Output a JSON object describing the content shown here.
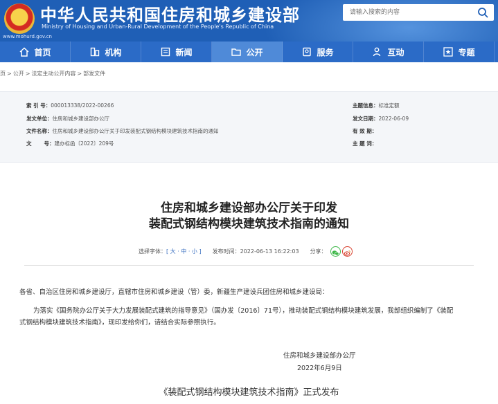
{
  "header": {
    "title_cn": "中华人民共和国住房和城乡建设部",
    "title_en": "Ministry of Housing and Urban-Rural Development of the People's Republic of China",
    "site_url": "www.mohurd.gov.cn",
    "search_placeholder": "请输入搜索的内容"
  },
  "nav": {
    "items": [
      {
        "label": "首页",
        "icon": "home-icon"
      },
      {
        "label": "机构",
        "icon": "building-icon"
      },
      {
        "label": "新闻",
        "icon": "news-icon"
      },
      {
        "label": "公开",
        "icon": "folder-icon",
        "active": true
      },
      {
        "label": "服务",
        "icon": "service-icon"
      },
      {
        "label": "互动",
        "icon": "user-icon"
      },
      {
        "label": "专题",
        "icon": "star-icon"
      }
    ]
  },
  "breadcrumb": [
    "页",
    "公开",
    "法定主动公开内容",
    "部发文件"
  ],
  "meta": {
    "index_label": "索 引 号：",
    "index_value": "000013338/2022-00266",
    "issuer_label": "发文单位：",
    "issuer_value": "住房和城乡建设部办公厅",
    "filename_label": "文件名称：",
    "filename_value": "住房和城乡建设部办公厅关于印发装配式钢结构模块建筑技术指南的通知",
    "docno_label": "文",
    "docno_label2": "号：",
    "docno_value": "建办标函〔2022〕209号",
    "topic_label": "主题信息：",
    "topic_value": "标准定额",
    "date_label": "发文日期：",
    "date_value": "2022-06-09",
    "valid_label": "有 效 期：",
    "valid_value": "",
    "keywords_label": "主 题 词：",
    "keywords_value": ""
  },
  "article": {
    "title_line1": "住房和城乡建设部办公厅关于印发",
    "title_line2": "装配式钢结构模块建筑技术指南的通知",
    "font_label": "选择字体：",
    "font_sizes": "[ 大 · 中 · 小 ]",
    "publish_label": "发布时间：",
    "publish_time": "2022-06-13 16:22:03",
    "share_label": "分享：",
    "salutation": "各省、自治区住房和城乡建设厅，直辖市住房和城乡建设（管）委，新疆生产建设兵团住房和城乡建设局：",
    "para1_line1": "为落实《国务院办公厅关于大力发展装配式建筑的指导意见》（国办发〔2016〕71号），推动装配式钢结构模块建筑发展，我部组织编制了《装配",
    "para1_line2": "式钢结构模块建筑技术指南》，现印发给你们，请结合实际参照执行。",
    "sign_org": "住房和城乡建设部办公厅",
    "sign_date": "2022年6月9日",
    "release": "《装配式钢结构模块建筑技术指南》正式发布"
  },
  "colors": {
    "header_blue": "#1f5fb6",
    "nav_blue": "#2b6bc7",
    "nav_active": "#4f8ad8",
    "emblem_red": "#d42b22",
    "emblem_gold": "#f7d24b"
  }
}
